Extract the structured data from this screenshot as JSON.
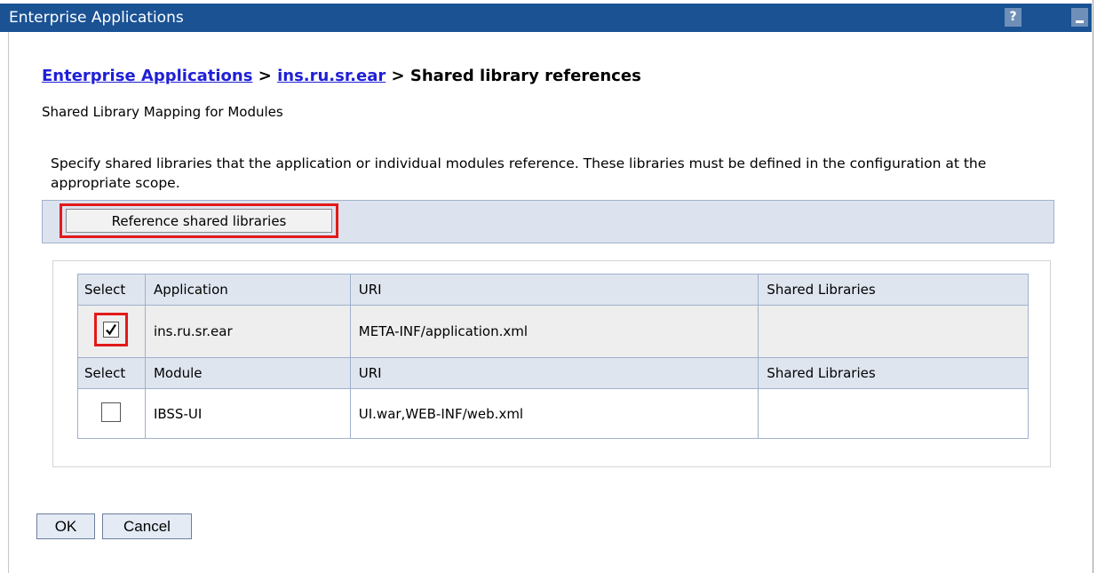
{
  "window": {
    "title": "Enterprise Applications",
    "help_glyph": "?",
    "minimize_icon": "minimize-icon"
  },
  "breadcrumb": {
    "link1": "Enterprise Applications",
    "sep1": " > ",
    "link2": "ins.ru.sr.ear",
    "sep2": " > ",
    "current": "Shared library references"
  },
  "subtitle": "Shared Library Mapping for Modules",
  "description": "Specify shared libraries that the application or individual modules reference. These libraries must be defined in the configuration at the appropriate scope.",
  "toolbar": {
    "reference_button": "Reference shared libraries"
  },
  "table": {
    "app_headers": [
      "Select",
      "Application",
      "URI",
      "Shared Libraries"
    ],
    "app_row": {
      "checked": true,
      "name": "ins.ru.sr.ear",
      "uri": "META-INF/application.xml",
      "shared_libraries": ""
    },
    "module_headers": [
      "Select",
      "Module",
      "URI",
      "Shared Libraries"
    ],
    "module_row": {
      "checked": false,
      "name": "IBSS-UI",
      "uri": "UI.war,WEB-INF/web.xml",
      "shared_libraries": ""
    }
  },
  "buttons": {
    "ok": "OK",
    "cancel": "Cancel"
  },
  "colors": {
    "titlebar": "#1a5294",
    "link": "#1f1fd6",
    "highlight": "#e21a1a",
    "header_bg": "#dfe5ef"
  }
}
